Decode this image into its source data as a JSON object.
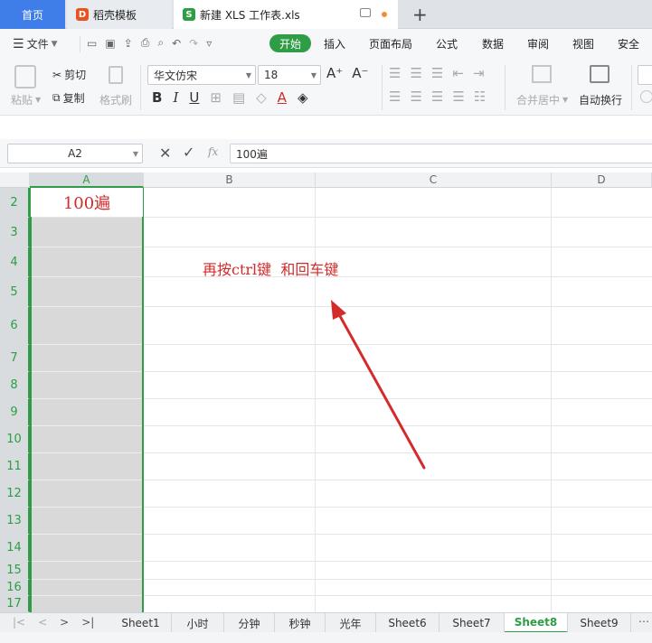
{
  "tabs": {
    "home": "首页",
    "docer": "稻壳模板",
    "file": "新建 XLS 工作表.xls",
    "new_tab": "+"
  },
  "menu": {
    "file": "文件",
    "start": "开始",
    "insert": "插入",
    "layout": "页面布局",
    "formula": "公式",
    "data": "数据",
    "review": "审阅",
    "view": "视图",
    "security": "安全"
  },
  "ribbon": {
    "paste": "粘贴",
    "cut": "剪切",
    "copy": "复制",
    "format_painter": "格式刷",
    "font_name": "华文仿宋",
    "font_size": "18",
    "merge_center": "合并居中",
    "wrap_text": "自动换行"
  },
  "formula_bar": {
    "name_box": "A2",
    "fx": "fx",
    "content": "100遍"
  },
  "columns": [
    "A",
    "B",
    "C",
    "D"
  ],
  "rows": [
    "2",
    "3",
    "4",
    "5",
    "6",
    "7",
    "8",
    "9",
    "10",
    "11",
    "12",
    "13",
    "14",
    "15",
    "16",
    "17"
  ],
  "cells": {
    "A2": "100遍",
    "B4": "再按ctrl键  和回车键"
  },
  "sheets": [
    "Sheet1",
    "小时",
    "分钟",
    "秒钟",
    "光年",
    "Sheet6",
    "Sheet7",
    "Sheet8",
    "Sheet9"
  ],
  "active_sheet": "Sheet8",
  "colors": {
    "accent_green": "#2e9d45",
    "tab_blue": "#3f7ee8",
    "annotation_red": "#d42a2a",
    "selection_gray": "#d9d9d9"
  }
}
